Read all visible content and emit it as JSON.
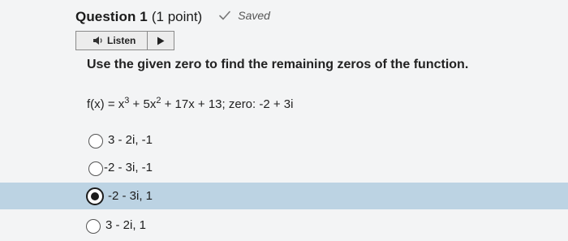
{
  "question": {
    "title": "Question 1",
    "points": "(1 point)",
    "status": "Saved",
    "status_icon": "check-icon"
  },
  "listen": {
    "label": "Listen",
    "speaker_icon": "speaker-icon",
    "play_icon": "play-icon"
  },
  "prompt": "Use the given zero to find the remaining zeros of the function.",
  "equation": {
    "lhs": "f(x) = x",
    "exp1": "3",
    "mid": " + 5x",
    "exp2": "2",
    "rhs": " + 17x + 13; zero: -2 + 3i"
  },
  "choices": [
    {
      "label": "3 - 2i, -1",
      "selected": false
    },
    {
      "label": "-2 - 3i, -1",
      "selected": false
    },
    {
      "label": "-2 - 3i, 1",
      "selected": true
    },
    {
      "label": "3 - 2i, 1",
      "selected": false
    }
  ],
  "colors": {
    "background": "#f3f4f5",
    "selected_row": "#bcd3e3",
    "text": "#1b1b1b"
  }
}
